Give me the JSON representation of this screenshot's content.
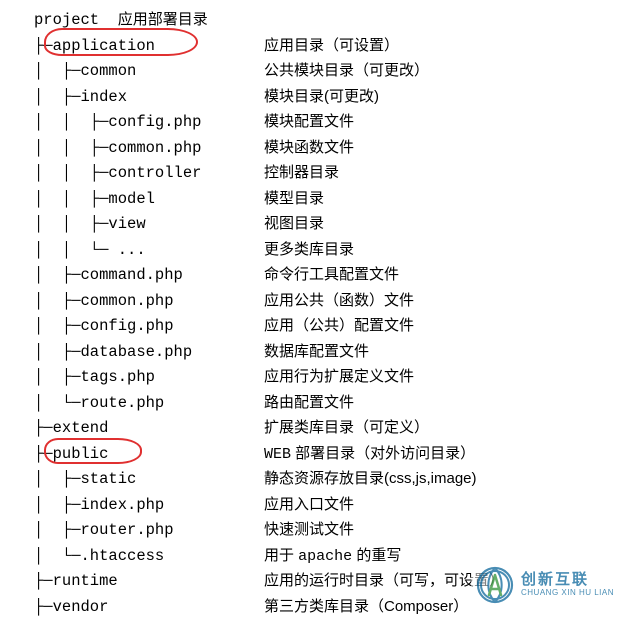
{
  "tree": [
    {
      "prefix": "project  ",
      "name": "",
      "desc_prefix": "",
      "desc": "应用部署目录",
      "same_col": true
    },
    {
      "prefix": "├─",
      "name": "application",
      "desc": "应用目录（可设置）"
    },
    {
      "prefix": "│  ├─",
      "name": "common",
      "desc": "公共模块目录（可更改）"
    },
    {
      "prefix": "│  ├─",
      "name": "index",
      "desc": "模块目录(可更改)"
    },
    {
      "prefix": "│  │  ├─",
      "name": "config.php",
      "desc": "模块配置文件"
    },
    {
      "prefix": "│  │  ├─",
      "name": "common.php",
      "desc": "模块函数文件"
    },
    {
      "prefix": "│  │  ├─",
      "name": "controller",
      "desc": "控制器目录"
    },
    {
      "prefix": "│  │  ├─",
      "name": "model",
      "desc": "模型目录"
    },
    {
      "prefix": "│  │  ├─",
      "name": "view",
      "desc": "视图目录"
    },
    {
      "prefix": "│  │  └─ ",
      "name": "...",
      "desc": "更多类库目录"
    },
    {
      "prefix": "│  ├─",
      "name": "command.php",
      "desc": "命令行工具配置文件"
    },
    {
      "prefix": "│  ├─",
      "name": "common.php",
      "desc": "应用公共（函数）文件"
    },
    {
      "prefix": "│  ├─",
      "name": "config.php",
      "desc": "应用（公共）配置文件"
    },
    {
      "prefix": "│  ├─",
      "name": "database.php",
      "desc": "数据库配置文件"
    },
    {
      "prefix": "│  ├─",
      "name": "tags.php",
      "desc": "应用行为扩展定义文件"
    },
    {
      "prefix": "│  └─",
      "name": "route.php",
      "desc": "路由配置文件"
    },
    {
      "prefix": "├─",
      "name": "extend",
      "desc": "扩展类库目录（可定义）"
    },
    {
      "prefix": "├─",
      "name": "public",
      "desc_html": true,
      "desc_kw": "WEB",
      "desc_rest": " 部署目录（对外访问目录）"
    },
    {
      "prefix": "│  ├─",
      "name": "static",
      "desc": "静态资源存放目录(css,js,image)"
    },
    {
      "prefix": "│  ├─",
      "name": "index.php",
      "desc": "应用入口文件"
    },
    {
      "prefix": "│  ├─",
      "name": "router.php",
      "desc": "快速测试文件"
    },
    {
      "prefix": "│  └─",
      "name": ".htaccess",
      "desc_html2": true,
      "desc_pre": "用于 ",
      "desc_kw": "apache",
      "desc_post": " 的重写"
    },
    {
      "prefix": "├─",
      "name": "runtime",
      "desc": "应用的运行时目录（可写，可设置）"
    },
    {
      "prefix": "├─",
      "name": "vendor",
      "desc": "第三方类库目录（Composer）"
    }
  ],
  "logo": {
    "cn": "创新互联",
    "en": "CHUANG XIN HU LIAN"
  }
}
